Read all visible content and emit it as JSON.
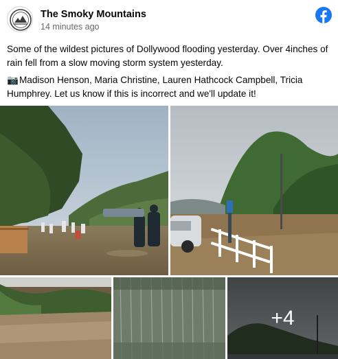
{
  "post": {
    "page_name": "The Smoky Mountains",
    "timestamp": "14 minutes ago",
    "paragraph_1": "Some of the wildest pictures of Dollywood flooding yesterday. Over 4inches of rain fell from a slow moving storm system yesterday.",
    "camera_emoji": "📷",
    "paragraph_2": "Madison Henson, Maria Christine, Lauren Hathcock Campbell, Tricia Humphrey. Let us know if this is incorrect and we'll update it!"
  },
  "photos": {
    "more_count": "+4"
  },
  "colors": {
    "facebook_blue": "#1877f2",
    "text": "#050505",
    "secondary_text": "#65676b"
  },
  "icons": {
    "brand": "facebook-icon",
    "camera": "camera-emoji"
  }
}
